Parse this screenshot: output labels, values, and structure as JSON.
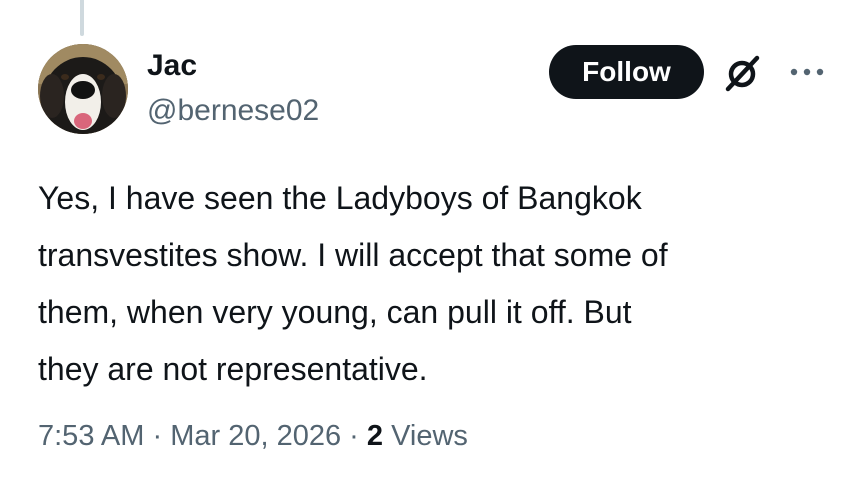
{
  "tweet": {
    "author": {
      "display_name": "Jac",
      "handle": "@bernese02"
    },
    "follow_label": "Follow",
    "text": "Yes, I have seen the Ladyboys of Bangkok\ntransvestites show. I will accept that some of\nthem, when very young, can pull it off.  But\nthey are not representative.",
    "time": "7:53 AM",
    "separator": "·",
    "date": "Mar 20, 2026",
    "views_count": "2",
    "views_label": "Views"
  },
  "icons": {
    "grok": "grok-icon",
    "more": "more-icon"
  },
  "colors": {
    "text": "#0f1419",
    "secondary_text": "#536471",
    "follow_bg": "#0f1419",
    "thread_line": "#cfd9de"
  }
}
